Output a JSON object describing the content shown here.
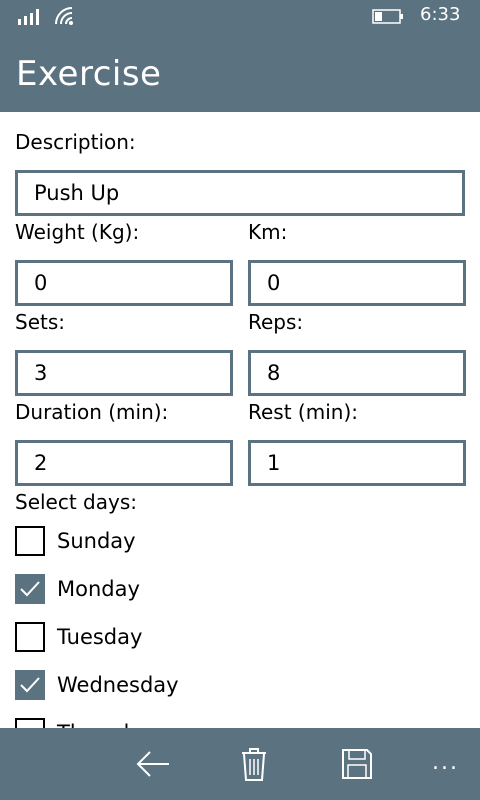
{
  "status": {
    "time": "6:33"
  },
  "header": {
    "title": "Exercise"
  },
  "form": {
    "description_label": "Description:",
    "description_value": "Push Up",
    "weight_label": "Weight (Kg):",
    "weight_value": "0",
    "km_label": "Km:",
    "km_value": "0",
    "sets_label": "Sets:",
    "sets_value": "3",
    "reps_label": "Reps:",
    "reps_value": "8",
    "duration_label": "Duration (min):",
    "duration_value": "2",
    "rest_label": "Rest (min):",
    "rest_value": "1",
    "days_label": "Select days:",
    "days": [
      {
        "label": "Sunday",
        "checked": false
      },
      {
        "label": "Monday",
        "checked": true
      },
      {
        "label": "Tuesday",
        "checked": false
      },
      {
        "label": "Wednesday",
        "checked": true
      },
      {
        "label": "Thursday",
        "checked": false
      }
    ]
  },
  "app_bar": {
    "back_icon": "arrow-left-icon",
    "delete_icon": "trash-icon",
    "save_icon": "floppy-disk-icon",
    "more": "..."
  },
  "colors": {
    "accent": "#5b7280",
    "background": "#ffffff"
  }
}
